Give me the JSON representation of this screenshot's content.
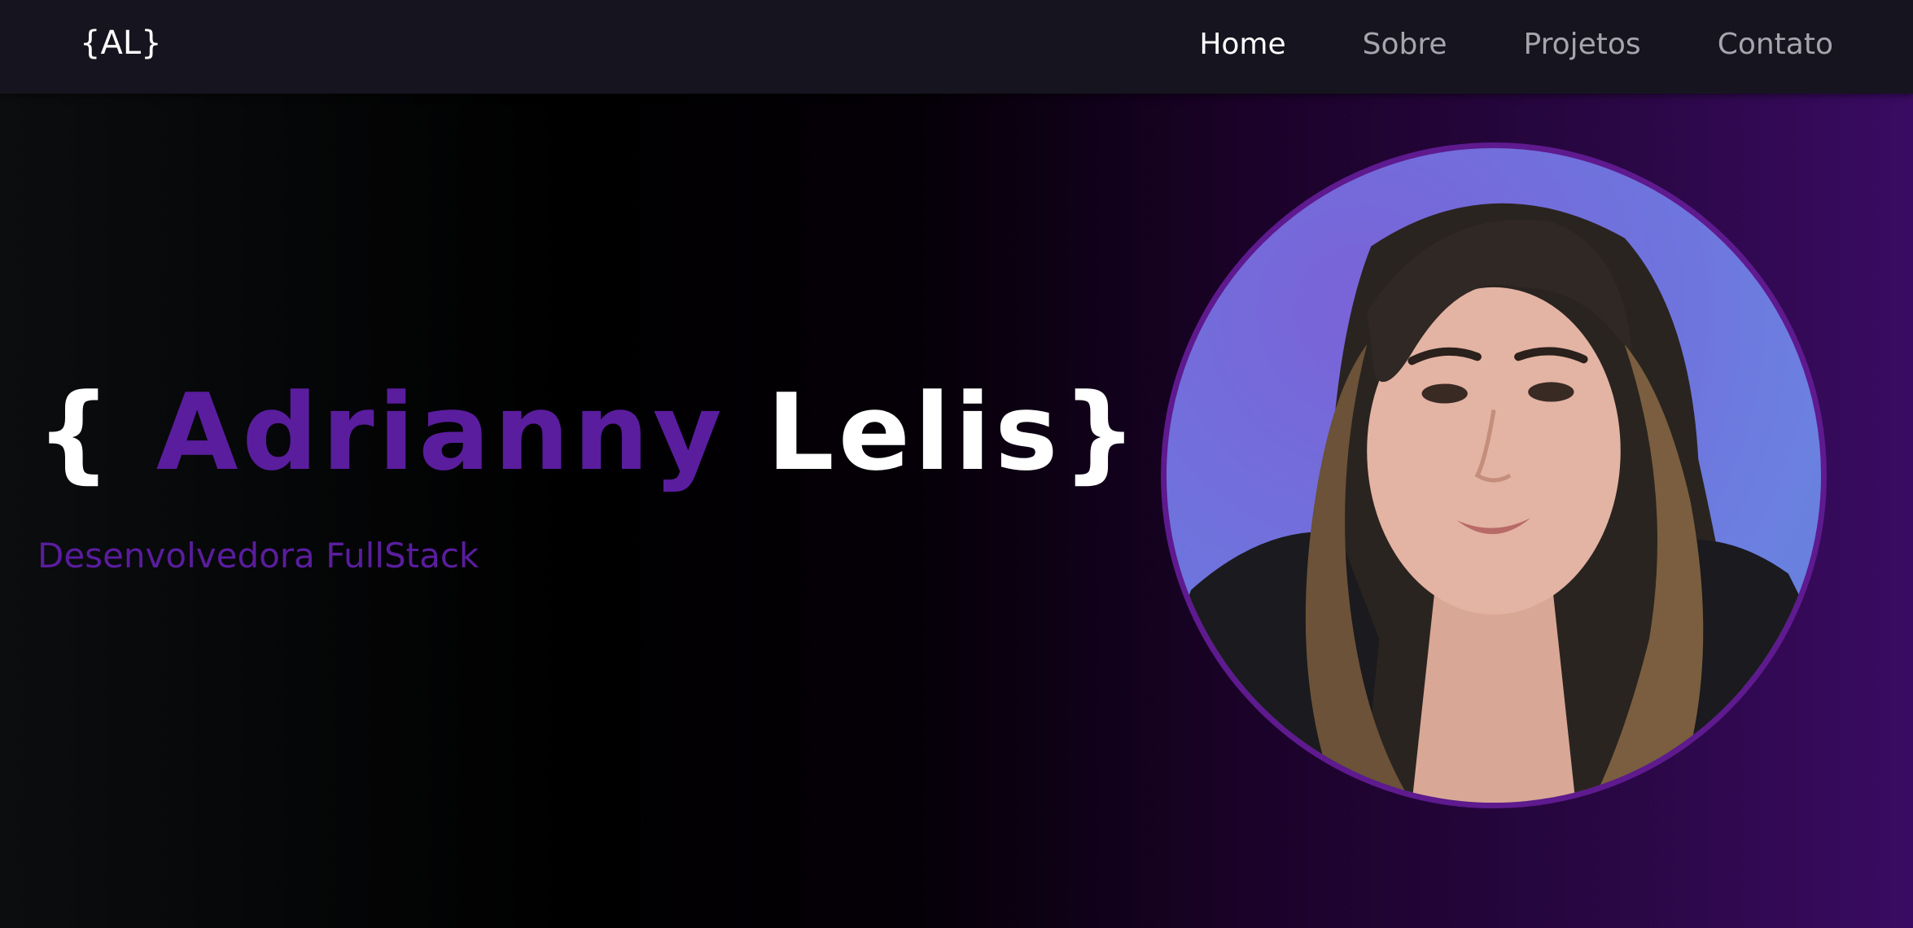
{
  "navbar": {
    "logo": "{AL}",
    "links": [
      {
        "label": "Home",
        "active": true
      },
      {
        "label": "Sobre",
        "active": false
      },
      {
        "label": "Projetos",
        "active": false
      },
      {
        "label": "Contato",
        "active": false
      }
    ]
  },
  "hero": {
    "title_open": "{ ",
    "first_name": "Adrianny",
    "last_name": " Lelis",
    "title_close": "}",
    "subtitle": "Desenvolvedora FullStack"
  },
  "colors": {
    "accent": "#5a1d9e",
    "navbar_bg": "#16151f",
    "avatar_border": "#5e1a8e",
    "photo_bg": "#6f73dd"
  },
  "avatar": {
    "icon": "profile-photo"
  }
}
